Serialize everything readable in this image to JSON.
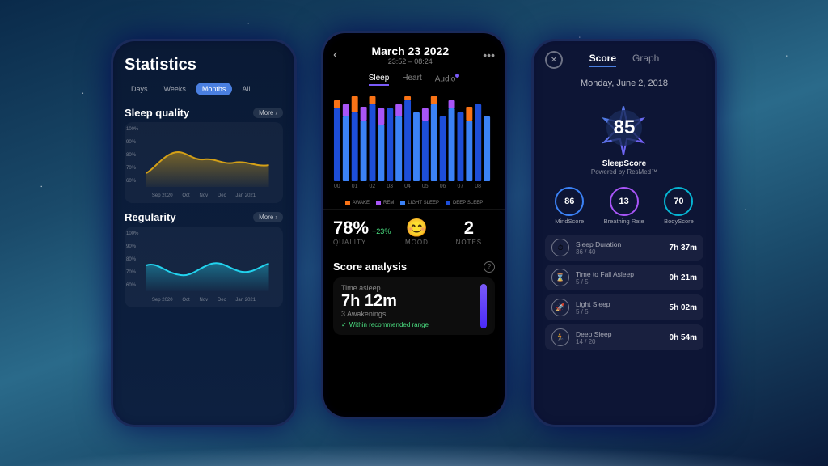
{
  "background": {
    "gradient": "teal-night-sky"
  },
  "phone1": {
    "title": "Statistics",
    "time_filters": [
      "Days",
      "Weeks",
      "Months",
      "All"
    ],
    "active_filter": "Months",
    "sleep_quality": {
      "section_title": "Sleep quality",
      "more_btn": "More",
      "y_labels": [
        "100%",
        "90%",
        "80%",
        "70%",
        "60%"
      ],
      "x_labels": [
        "Sep 2020",
        "Oct",
        "Nov",
        "Dec",
        "Jan 2021"
      ]
    },
    "regularity": {
      "section_title": "Regularity",
      "more_btn": "More",
      "y_labels": [
        "100%",
        "90%",
        "80%",
        "70%",
        "60%"
      ],
      "x_labels": [
        "Sep 2020",
        "Oct",
        "Nov",
        "Dec",
        "Jan 2021"
      ]
    }
  },
  "phone2": {
    "back_icon": "‹",
    "date": "March 23 2022",
    "time_range": "23:52 – 08:24",
    "tabs": [
      "Sleep",
      "Heart",
      "Audio"
    ],
    "active_tab": "Sleep",
    "legend": [
      {
        "label": "AWAKE",
        "color": "#f97316"
      },
      {
        "label": "REM",
        "color": "#a855f7"
      },
      {
        "label": "LIGHT SLEEP",
        "color": "#3b82f6"
      },
      {
        "label": "DEEP SLEEP",
        "color": "#1d4ed8"
      }
    ],
    "quality_pct": "78%",
    "quality_change": "+23%",
    "quality_label": "QUALITY",
    "mood_emoji": "😊",
    "mood_label": "MOOD",
    "notes_count": "2",
    "notes_label": "NOTES",
    "score_analysis_title": "Score analysis",
    "time_asleep_label": "Time asleep",
    "time_asleep_value": "7h 12m",
    "awakenings": "3 Awakenings",
    "within_range": "Within recommended range"
  },
  "phone3": {
    "close_icon": "✕",
    "tabs": [
      "Score",
      "Graph"
    ],
    "active_tab": "Score",
    "date": "Monday, June 2, 2018",
    "sleep_score": "85",
    "score_label": "SleepScore",
    "score_sub": "Powered by ResMed™",
    "sub_scores": [
      {
        "label": "MindScore",
        "value": "86",
        "color": "#3b82f6"
      },
      {
        "label": "Breathing Rate",
        "value": "13",
        "color": "#a855f7"
      },
      {
        "label": "BodyScore",
        "value": "70",
        "color": "#06b6d4"
      }
    ],
    "metrics": [
      {
        "icon": "⏱",
        "name": "Sleep Duration",
        "score": "36 / 40",
        "value": "7h 37m"
      },
      {
        "icon": "⌛",
        "name": "Time to Fall Asleep",
        "score": "5 / 5",
        "value": "0h 21m"
      },
      {
        "icon": "🚀",
        "name": "Light Sleep",
        "score": "5 / 5",
        "value": "5h 02m"
      },
      {
        "icon": "🏃",
        "name": "Deep Sleep",
        "score": "14 / 20",
        "value": "0h 54m"
      }
    ]
  }
}
